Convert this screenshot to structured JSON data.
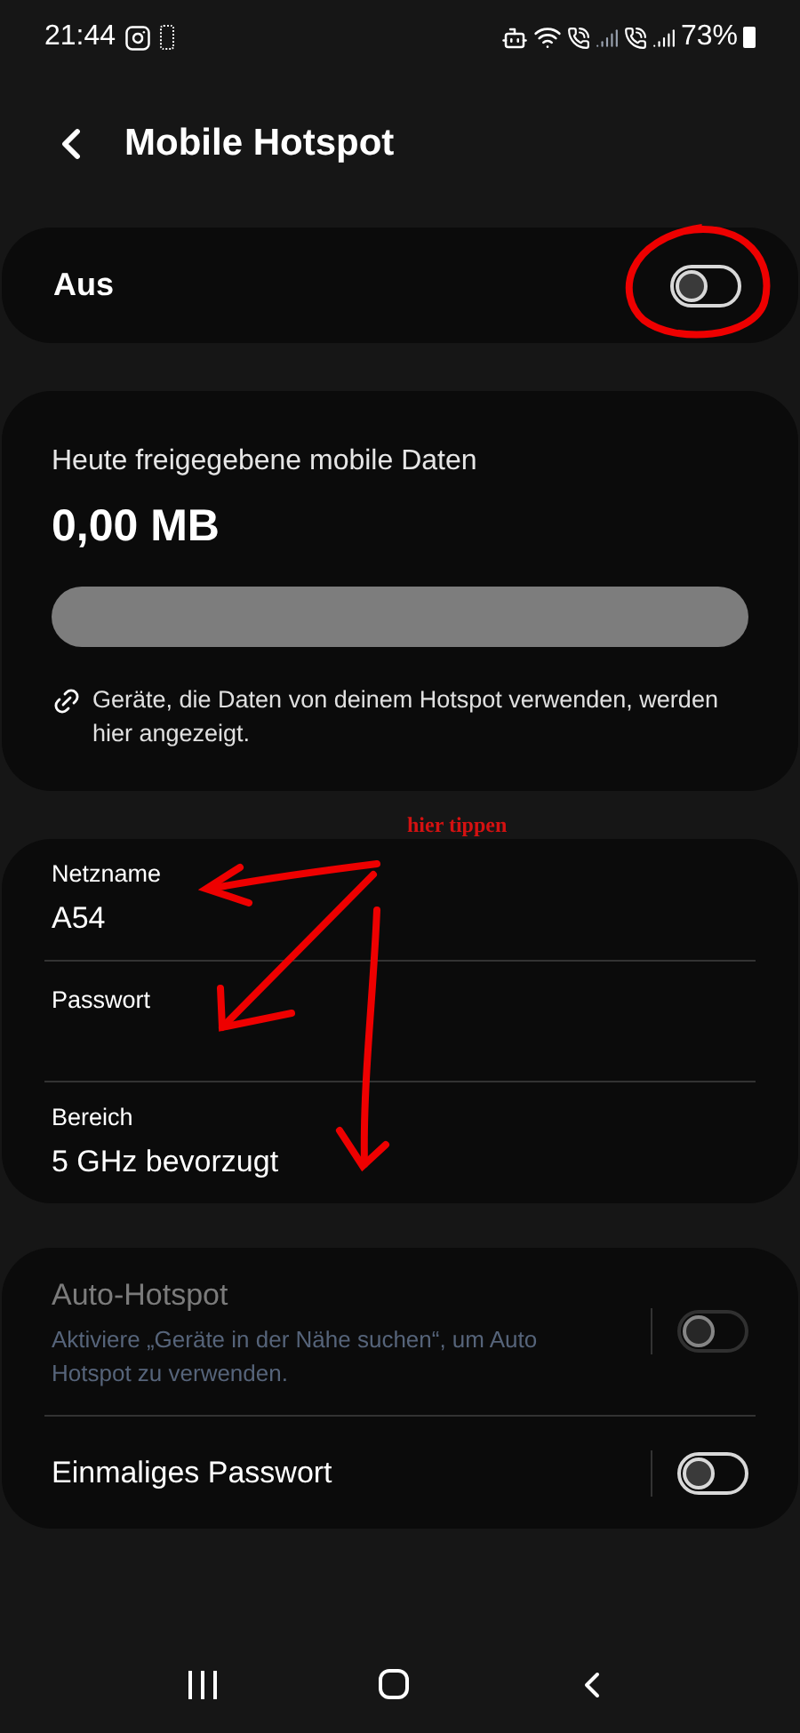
{
  "status_bar": {
    "time": "21:44",
    "battery": "73%"
  },
  "header": {
    "title": "Mobile Hotspot"
  },
  "main_switch": {
    "label": "Aus",
    "on": false
  },
  "usage": {
    "label": "Heute freigegebene mobile Daten",
    "value": "0,00 MB",
    "level": 0,
    "note": "Geräte, die Daten von deinem Hotspot verwenden, werden hier angezeigt."
  },
  "network": [
    {
      "label": "Netzname",
      "value": "A54"
    },
    {
      "label": "Passwort"
    },
    {
      "label": "Bereich",
      "value": "5 GHz bevorzugt"
    }
  ],
  "options": [
    {
      "title": "Auto-Hotspot",
      "subtitle": "Aktiviere „Geräte in der Nähe suchen“, um Auto Hotspot zu verwenden.",
      "on": false,
      "disabled": true
    },
    {
      "title": "Einmaliges Passwort",
      "on": false,
      "disabled": false
    }
  ],
  "annotation": {
    "text": "hier tippen"
  }
}
